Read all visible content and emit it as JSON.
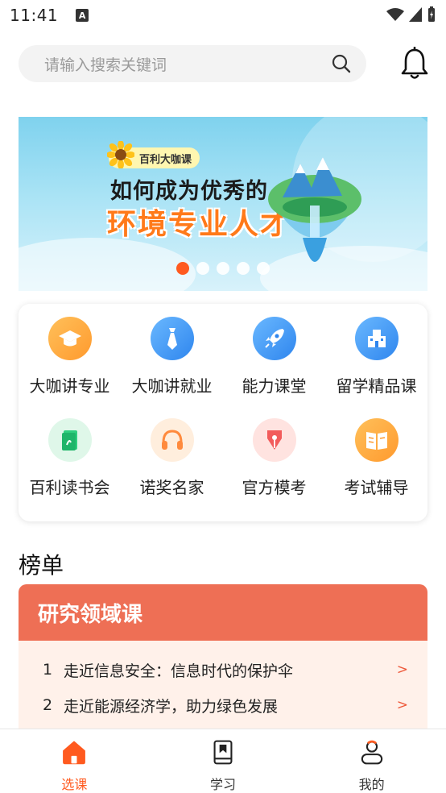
{
  "status_bar": {
    "time": "11:41",
    "notif_icon_letter": "A"
  },
  "search": {
    "placeholder": "请输入搜索关键词"
  },
  "banner": {
    "badge": "百利大咖课",
    "title_line1": "如何成为优秀的",
    "title_line2": "环境专业人才",
    "dots": 5,
    "active_dot": 0
  },
  "categories": [
    {
      "label": "大咖讲专业",
      "icon": "graduation-cap-icon",
      "color": "#ffa540"
    },
    {
      "label": "大咖讲就业",
      "icon": "tie-icon",
      "color": "#3d9bf5"
    },
    {
      "label": "能力课堂",
      "icon": "rocket-icon",
      "color": "#3d9bf5"
    },
    {
      "label": "留学精品课",
      "icon": "building-icon",
      "color": "#3d9bf5"
    },
    {
      "label": "百利读书会",
      "icon": "book-icon",
      "color": "#2fcf7f"
    },
    {
      "label": "诺奖名家",
      "icon": "headphones-icon",
      "color": "#ff8a3d"
    },
    {
      "label": "官方模考",
      "icon": "pen-nib-icon",
      "color": "#f25b5b"
    },
    {
      "label": "考试辅导",
      "icon": "open-book-icon",
      "color": "#ffa540"
    }
  ],
  "ranking": {
    "section_title": "榜单",
    "card_title": "研究领域课",
    "items": [
      {
        "num": "1",
        "title": "走近信息安全：信息时代的保护伞",
        "arrow": ">"
      },
      {
        "num": "2",
        "title": "走近能源经济学，助力绿色发展",
        "arrow": ">"
      }
    ]
  },
  "tabbar": {
    "tabs": [
      {
        "label": "选课",
        "icon": "home-icon",
        "active": true
      },
      {
        "label": "学习",
        "icon": "bookmark-icon",
        "active": false
      },
      {
        "label": "我的",
        "icon": "user-icon",
        "active": false
      }
    ]
  },
  "colors": {
    "accent": "#ff5a1f",
    "rank_header": "#ee6f55",
    "rank_body": "#fff1ea"
  }
}
